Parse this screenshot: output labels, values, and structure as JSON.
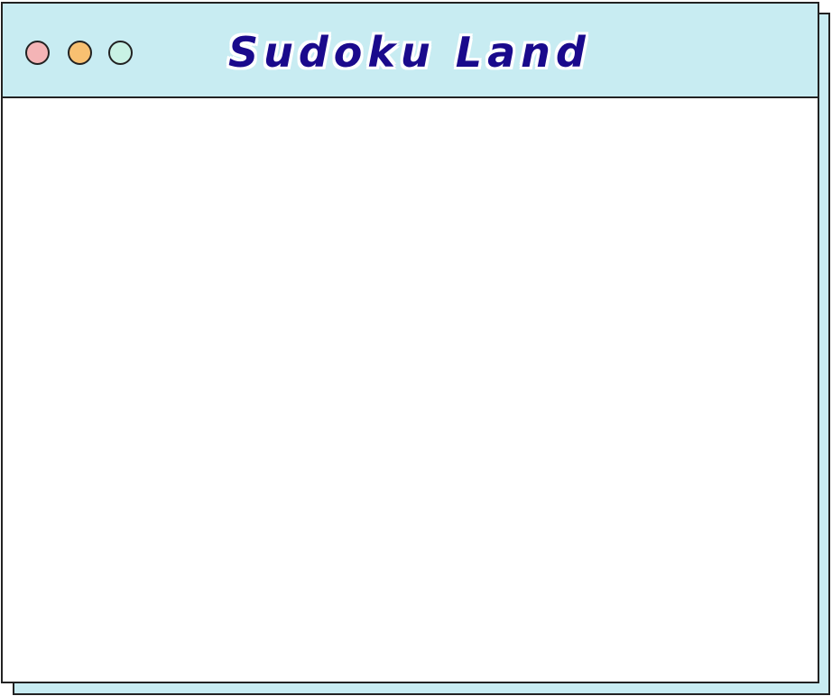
{
  "window": {
    "title": "Sudoku Land",
    "controls": {
      "close": {
        "icon": "close-dot-icon",
        "color": "#f4b4b6"
      },
      "minimize": {
        "icon": "minimize-dot-icon",
        "color": "#f8c071"
      },
      "maximize": {
        "icon": "maximize-dot-icon",
        "color": "#c9f2e4"
      }
    }
  },
  "colors": {
    "titlebar": "#c8ecf2",
    "shadow": "#c8ecf2",
    "border": "#222222",
    "title_text": "#1a0a8c",
    "content": "#ffffff"
  }
}
